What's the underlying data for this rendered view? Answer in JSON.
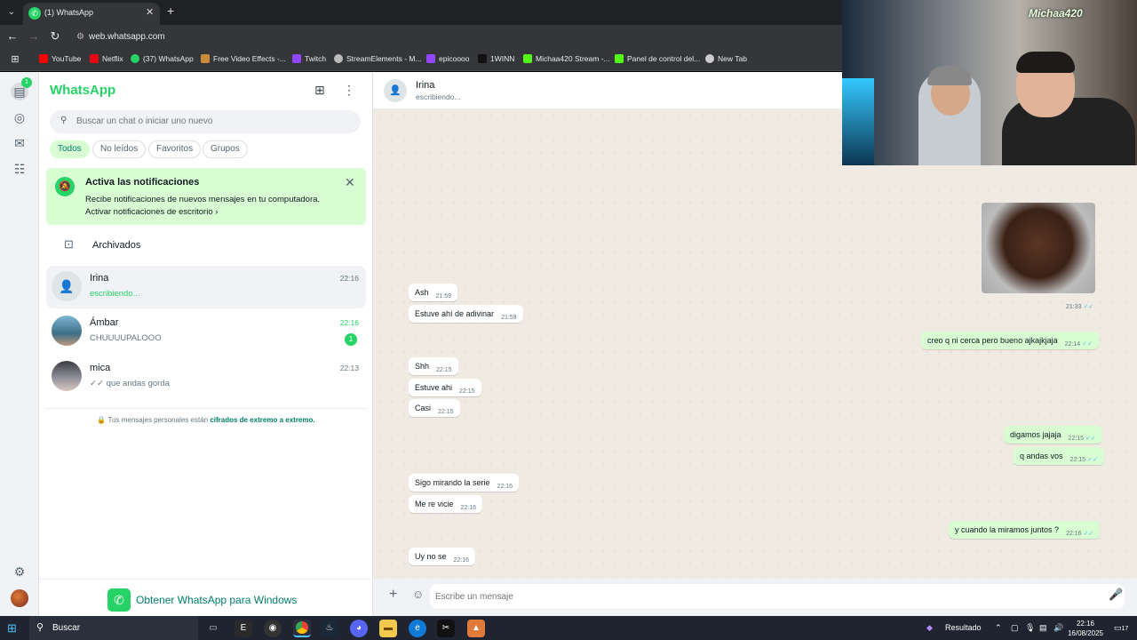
{
  "browser": {
    "tab_title": "(1) WhatsApp",
    "url": "web.whatsapp.com",
    "bookmarks": [
      "YouTube",
      "Netflix",
      "(37) WhatsApp",
      "Free Video Effects -...",
      "Twitch",
      "StreamElements - M...",
      "epicoooo",
      "1WINN",
      "Michaa420 Stream -...",
      "Panel de control del...",
      "New Tab"
    ]
  },
  "sidebar": {
    "brand": "WhatsApp",
    "rail_badge": "1",
    "search_placeholder": "Buscar un chat o iniciar uno nuevo",
    "filters": [
      "Todos",
      "No leídos",
      "Favoritos",
      "Grupos"
    ],
    "notification": {
      "title": "Activa las notificaciones",
      "text": "Recibe notificaciones de nuevos mensajes en tu computadora.",
      "link": "Activar notificaciones de escritorio"
    },
    "archived_label": "Archivados",
    "chats": [
      {
        "name": "Irina",
        "time": "22:16",
        "preview": "escribiendo..."
      },
      {
        "name": "Ámbar",
        "time": "22:16",
        "preview": "CHUUUUPALOOO",
        "unread": "1"
      },
      {
        "name": "mica",
        "time": "22:13",
        "preview": "que andas gorda"
      }
    ],
    "e2e_text": "Tus mensajes personales están",
    "e2e_link": "cifrados de extremo a extremo.",
    "get_windows": "Obtener WhatsApp para Windows"
  },
  "conversation": {
    "name": "Irina",
    "status": "escribiendo...",
    "image_time": "21:33",
    "messages": [
      {
        "dir": "in",
        "text": "Ash",
        "time": "21:59"
      },
      {
        "dir": "in",
        "text": "Estuve ahí de adivinar",
        "time": "21:59"
      },
      {
        "dir": "out",
        "text": "creo q ni cerca pero bueno ajkajkjaja",
        "time": "22:14"
      },
      {
        "dir": "in",
        "text": "Shh",
        "time": "22:15"
      },
      {
        "dir": "in",
        "text": "Estuve ahi",
        "time": "22:15"
      },
      {
        "dir": "in",
        "text": "Casi",
        "time": "22:15"
      },
      {
        "dir": "out",
        "text": "digamos jajaja",
        "time": "22:15"
      },
      {
        "dir": "out",
        "text": "q andas vos",
        "time": "22:15"
      },
      {
        "dir": "in",
        "text": "Sigo mirando la serie",
        "time": "22:16"
      },
      {
        "dir": "in",
        "text": "Me re vicie",
        "time": "22:16"
      },
      {
        "dir": "out",
        "text": "y cuando la miramos juntos ?",
        "time": "22:16"
      },
      {
        "dir": "in",
        "text": "Uy no se",
        "time": "22:16"
      }
    ],
    "composer_placeholder": "Escribe un mensaje"
  },
  "webcam": {
    "overlay_name": "Michaa420"
  },
  "taskbar": {
    "search_label": "Buscar",
    "tray_label": "Resultado",
    "time": "22:16",
    "date": "16/08/2025",
    "notif_count": "17"
  },
  "colors": {
    "brand": "#25d366",
    "accent_dark": "#008069",
    "outgoing_bubble": "#d9fdd3",
    "read_ticks": "#53bdeb"
  }
}
